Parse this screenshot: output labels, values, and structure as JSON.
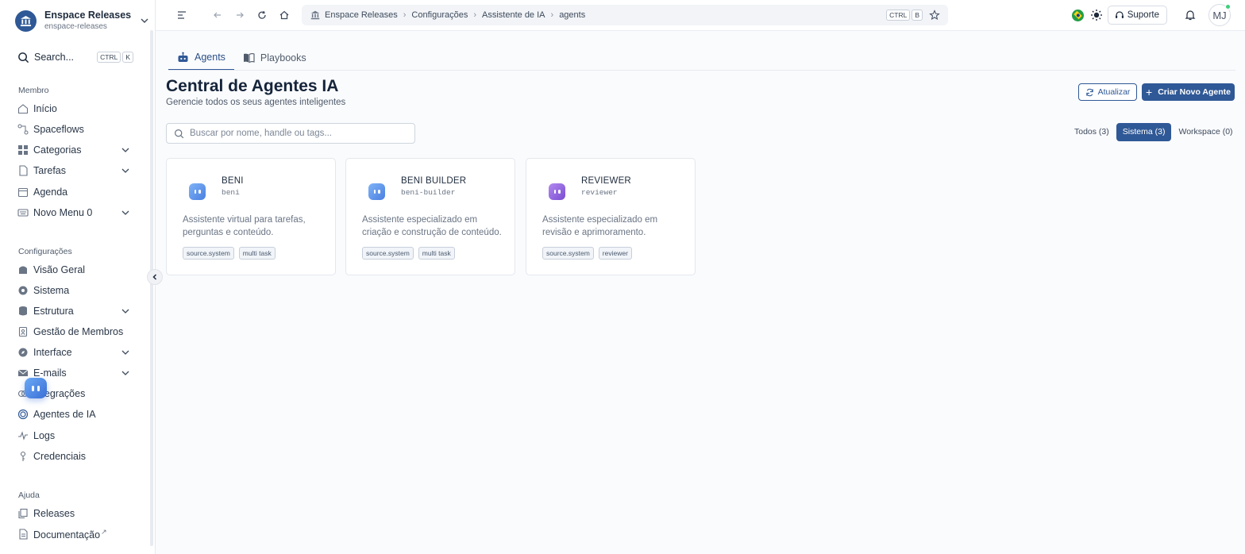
{
  "workspace": {
    "name": "Enspace Releases",
    "slug": "enspace-releases"
  },
  "sidebar": {
    "search": {
      "label": "Search...",
      "kbd": [
        "CTRL",
        "K"
      ]
    },
    "sections": [
      {
        "label": "Membro",
        "items": [
          {
            "label": "Início",
            "icon": "home-icon"
          },
          {
            "label": "Spaceflows",
            "icon": "flow-icon"
          },
          {
            "label": "Categorias",
            "icon": "grid-icon",
            "expandable": true
          },
          {
            "label": "Tarefas",
            "icon": "document-icon",
            "expandable": true
          },
          {
            "label": "Agenda",
            "icon": "calendar-icon"
          },
          {
            "label": "Novo Menu 0",
            "icon": "keyboard-icon",
            "expandable": true
          }
        ]
      },
      {
        "label": "Configurações",
        "items": [
          {
            "label": "Visão Geral",
            "icon": "overview-icon"
          },
          {
            "label": "Sistema",
            "icon": "gear-icon"
          },
          {
            "label": "Estrutura",
            "icon": "database-icon",
            "expandable": true
          },
          {
            "label": "Gestão de Membros",
            "icon": "members-icon"
          },
          {
            "label": "Interface",
            "icon": "compass-icon",
            "expandable": true
          },
          {
            "label": "E-mails",
            "icon": "mail-icon",
            "expandable": true
          },
          {
            "label": "Integrações",
            "icon": "integration-icon"
          },
          {
            "label": "Agentes de IA",
            "icon": "chip-icon"
          },
          {
            "label": "Logs",
            "icon": "activity-icon"
          },
          {
            "label": "Credenciais",
            "icon": "key-icon"
          }
        ]
      },
      {
        "label": "Ajuda",
        "items": [
          {
            "label": "Releases",
            "icon": "copy-icon"
          },
          {
            "label": "Documentação",
            "icon": "file-icon",
            "external": "↗"
          }
        ]
      }
    ]
  },
  "topbar": {
    "breadcrumb": [
      "Enspace Releases",
      "Configurações",
      "Assistente de IA",
      "agents"
    ],
    "shortcut": [
      "CTRL",
      "B"
    ],
    "support_label": "Suporte",
    "avatar_initials": "MJ"
  },
  "tabs": [
    {
      "label": "Agents",
      "icon": "robot-icon",
      "active": true
    },
    {
      "label": "Playbooks",
      "icon": "book-icon",
      "active": false
    }
  ],
  "page": {
    "title": "Central de Agentes IA",
    "subtitle": "Gerencie todos os seus agentes inteligentes",
    "refresh_label": "Atualizar",
    "new_agent_label": "Criar Novo Agente",
    "search_placeholder": "Buscar por nome, handle ou tags...",
    "filters": [
      {
        "label": "Todos (3)",
        "active": false
      },
      {
        "label": "Sistema (3)",
        "active": true
      },
      {
        "label": "Workspace (0)",
        "active": false
      }
    ]
  },
  "agents": [
    {
      "name": "BENI",
      "handle": "beni",
      "description": "Assistente virtual para tarefas, perguntas e conteúdo.",
      "tags": [
        "source.system",
        "multi task"
      ],
      "color": "#5b8fe8"
    },
    {
      "name": "BENI BUILDER",
      "handle": "beni-builder",
      "description": "Assistente especializado em criação e construção de conteúdo.",
      "tags": [
        "source.system",
        "multi task"
      ],
      "color": "#5b8fe8"
    },
    {
      "name": "REVIEWER",
      "handle": "reviewer",
      "description": "Assistente especializado em revisão e aprimoramento.",
      "tags": [
        "source.system",
        "reviewer"
      ],
      "color": "#8a5bd8"
    }
  ],
  "colors": {
    "primary": "#2f5896",
    "text": "#1e2b3c",
    "muted": "#6a7585",
    "border": "#e3e7ed"
  }
}
